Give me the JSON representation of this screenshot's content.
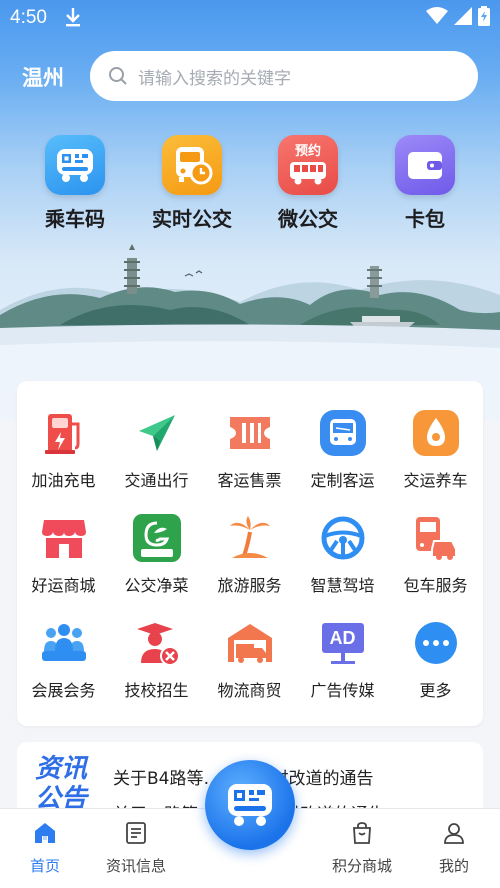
{
  "status": {
    "time": "4:50"
  },
  "header": {
    "city": "温州",
    "search_placeholder": "请输入搜索的关键字"
  },
  "quick_actions": [
    {
      "label": "乘车码",
      "icon": "bus-qr-icon",
      "color": "#34a6f4"
    },
    {
      "label": "实时公交",
      "icon": "bus-clock-icon",
      "color": "#f7a21b"
    },
    {
      "label": "微公交",
      "icon": "bus-reserve-icon",
      "color": "#ef5a55",
      "badge": "预约"
    },
    {
      "label": "卡包",
      "icon": "wallet-icon",
      "color": "#7e6cf2"
    }
  ],
  "services": [
    {
      "label": "加油充电",
      "icon": "fuel-charge-icon"
    },
    {
      "label": "交通出行",
      "icon": "paper-plane-icon"
    },
    {
      "label": "客运售票",
      "icon": "ticket-icon"
    },
    {
      "label": "定制客运",
      "icon": "custom-bus-icon"
    },
    {
      "label": "交运养车",
      "icon": "car-maintenance-icon"
    },
    {
      "label": "好运商城",
      "icon": "store-icon"
    },
    {
      "label": "公交净菜",
      "icon": "bus-vegetable-icon",
      "badge": "公交净菜"
    },
    {
      "label": "旅游服务",
      "icon": "palm-tree-icon"
    },
    {
      "label": "智慧驾培",
      "icon": "steering-wheel-icon"
    },
    {
      "label": "包车服务",
      "icon": "charter-bus-icon"
    },
    {
      "label": "会展会务",
      "icon": "conference-icon"
    },
    {
      "label": "技校招生",
      "icon": "graduate-icon"
    },
    {
      "label": "物流商贸",
      "icon": "logistics-icon"
    },
    {
      "label": "广告传媒",
      "icon": "ad-icon",
      "badge": "AD"
    },
    {
      "label": "更多",
      "icon": "more-icon"
    }
  ],
  "news": {
    "tag_top": "资讯",
    "tag_bottom": "公告",
    "items": [
      "关于B4路等…线路临时改道的通告",
      "关于…路等…线路临…时改道的通告"
    ]
  },
  "tabbar": [
    {
      "label": "首页",
      "icon": "home-icon",
      "active": true
    },
    {
      "label": "资讯信息",
      "icon": "news-icon",
      "active": false
    },
    {
      "label": "积分商城",
      "icon": "shopping-bag-icon",
      "active": false
    },
    {
      "label": "我的",
      "icon": "user-icon",
      "active": false
    }
  ],
  "colors": {
    "accent": "#2d7cf0",
    "hero_top": "#4a98ee"
  }
}
